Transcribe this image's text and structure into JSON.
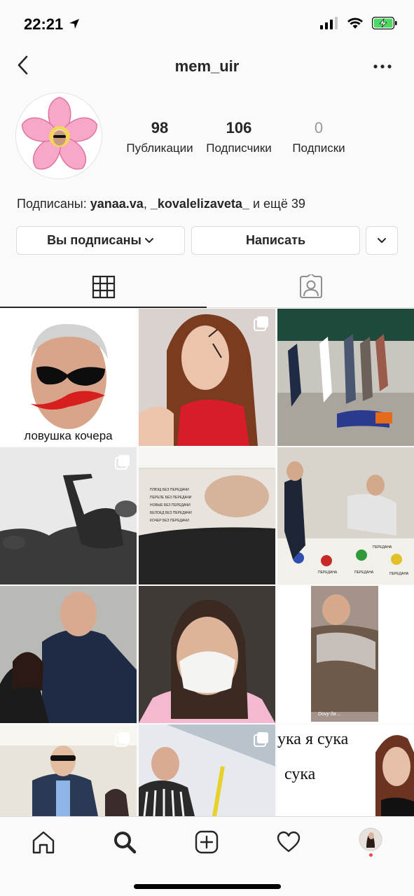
{
  "status_bar": {
    "time": "22:21"
  },
  "header": {
    "username": "mem_uir"
  },
  "stats": [
    {
      "value": "98",
      "label": "Публикации"
    },
    {
      "value": "106",
      "label": "Подписчики"
    },
    {
      "value": "0",
      "label": "Подписки"
    }
  ],
  "followed_by": {
    "prefix": "Подписаны: ",
    "user1": "yanaa.va",
    "sep": ", ",
    "user2": "_kovalelizaveta_",
    "suffix": " и ещё 39"
  },
  "buttons": {
    "following": "Вы подписаны",
    "message": "Написать"
  },
  "posts": [
    {
      "caption": "ловушка кочера"
    },
    {
      "caption": ""
    },
    {
      "caption": ""
    },
    {
      "caption": ""
    },
    {
      "caption": "",
      "lines": [
        "ПЛЮЩ БЕЗ ПЕРЕДАЧИ",
        "ПЕРЕЛЕ БЕЗ ПЕРЕДАЧИ",
        "НОВЫЕ БЕЗ ПЕРЕДАЧИ",
        "БЕЛОЕД БЕЗ ПЕРЕДАЧИ",
        "КОЧЕР БЕЗ ПЕРЕДАЧИ"
      ]
    },
    {
      "caption": "",
      "words": [
        "ПЕРЕДАНА",
        "ПЕРЕДАНА",
        "ПЕРЕДАНА",
        "ПЕРЕДАНА"
      ]
    },
    {
      "caption": ""
    },
    {
      "caption": ""
    },
    {
      "caption": "Dovy да ..."
    },
    {
      "caption": ""
    },
    {
      "caption": ""
    },
    {
      "caption": "",
      "line1": "ука я сука",
      "line2": "сука"
    }
  ],
  "colors": {
    "text": "#262626",
    "border": "#dbdbdb",
    "muted": "#999999",
    "background": "#fafafa"
  }
}
